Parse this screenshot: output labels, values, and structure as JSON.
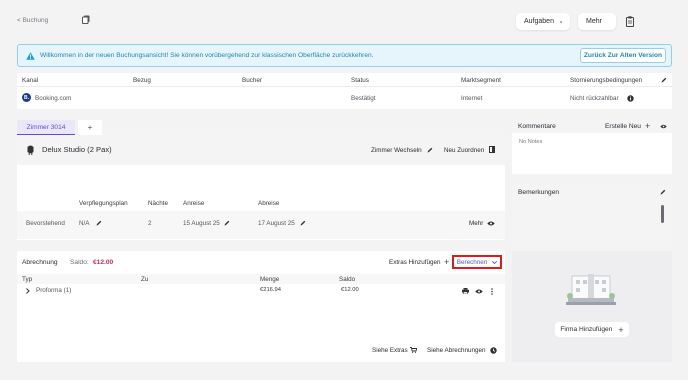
{
  "topbar": {
    "back_label": "< Buchung",
    "tasks_label": "Aufgaben",
    "more_label": "Mehr"
  },
  "banner": {
    "text": "Willkommen in der neuen Buchungsansicht! Sie können vorübergehend zur klassischen Oberfläche zurückkehren.",
    "button_label": "Zurück Zur Alten Version"
  },
  "booking_table": {
    "headers": [
      "Kanal",
      "Bezug",
      "Bucher",
      "Status",
      "Marktsegment",
      "Stornierungsbedingungen"
    ],
    "row": {
      "channel": "Booking.com",
      "channel_logo": "B.",
      "bezug": "",
      "bucher": "",
      "status": "Bestätigt",
      "segment": "Internet",
      "cancellation": "Nicht rückzahlbar"
    }
  },
  "room": {
    "tab_label": "Zimmer 3014",
    "add_tab": "+",
    "room_type": "Delux Studio (2 Pax)",
    "change_room": "Zimmer Wechseln",
    "reassign": "Neu Zuordnen",
    "stay_headers": [
      "Verpflegungsplan",
      "Nächte",
      "Anreise",
      "Abreise"
    ],
    "stay": {
      "status": "Bevorstehend",
      "meal_plan": "N/A",
      "nights": "2",
      "arrival": "15 August 25",
      "departure": "17 August 25",
      "more": "Mehr"
    }
  },
  "billing": {
    "title": "Abrechnung",
    "saldo_label": "Saldo:",
    "saldo_value": "€12.00",
    "add_extras": "Extras Hinzufügen",
    "calculate": "Berechnen",
    "headers": [
      "Typ",
      "Zu",
      "Menge",
      "Saldo"
    ],
    "row": {
      "type": "Proforma (1)",
      "to": "",
      "amount": "€216.94",
      "saldo": "€12.00"
    },
    "view_extras": "Siehe Extras",
    "view_invoices": "Siehe Abrechnungen"
  },
  "comments": {
    "title": "Kommentare",
    "create_new": "Erstelle Neu",
    "empty": "No Notes"
  },
  "remarks": {
    "title": "Bemerkungen"
  },
  "company": {
    "add_label": "Firma Hinzufügen"
  },
  "colors": {
    "accent": "#5b4fd6",
    "saldo": "#d8245c",
    "banner_bg": "#e6f5fb",
    "banner_border": "#8fd1ea",
    "highlight": "#e01b1b"
  }
}
